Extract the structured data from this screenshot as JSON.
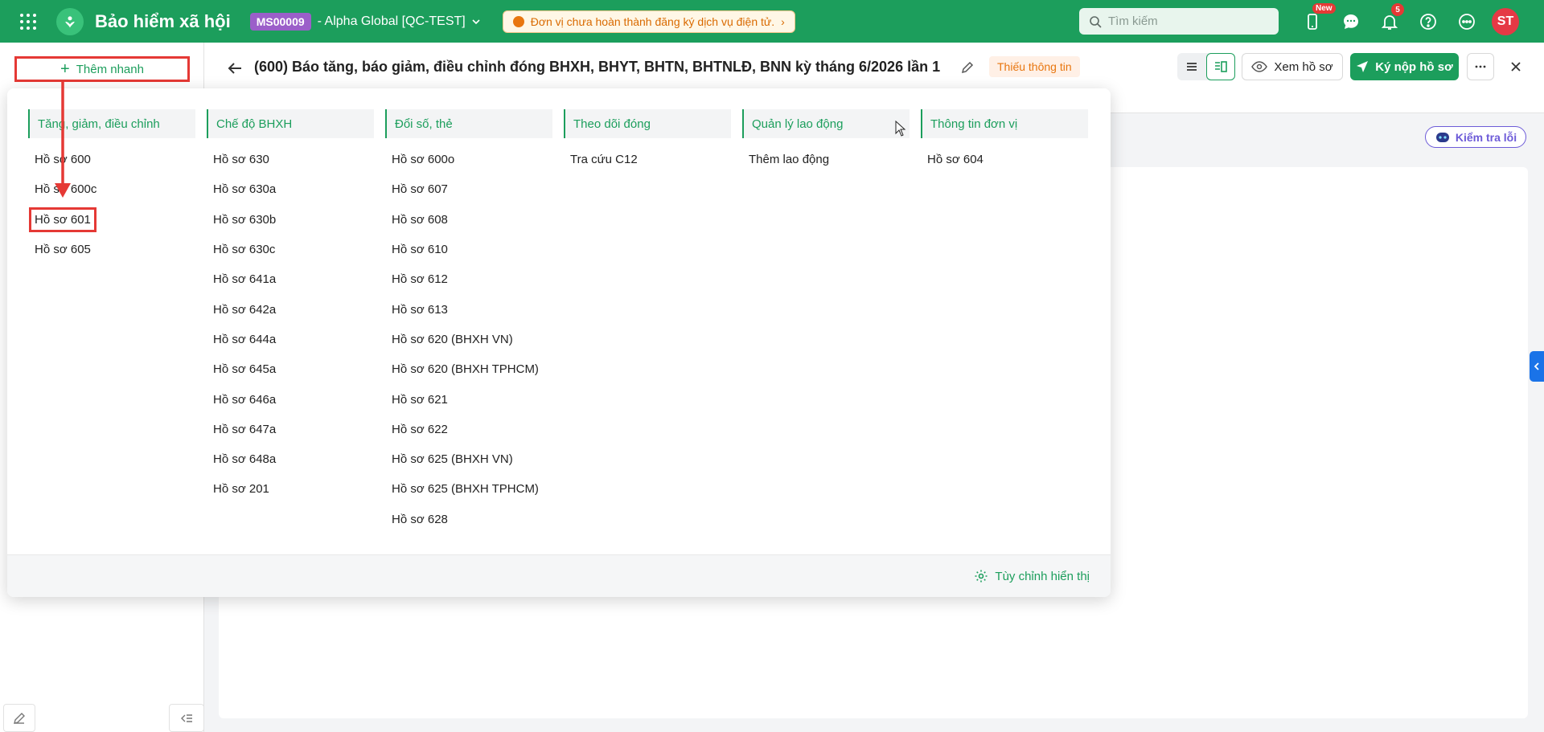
{
  "topbar": {
    "app_title": "Bảo hiểm xã hội",
    "org_code": "MS00009",
    "org_name": "- Alpha Global [QC-TEST]",
    "warning": "Đơn vị chưa hoàn thành đăng ký dịch vụ điện tử.",
    "search_placeholder": "Tìm kiếm",
    "new_badge": "New",
    "notification_count": "5",
    "avatar_initials": "ST",
    "colors": {
      "brand": "#1c9e5c",
      "org_badge": "#9b5fc9",
      "avatar": "#e53945"
    }
  },
  "sidebar": {
    "quick_add_label": "Thêm nhanh"
  },
  "header": {
    "title": "(600) Báo tăng, báo giảm, điều chỉnh đóng BHXH, BHYT, BHTN, BHTNLĐ, BNN kỳ tháng 6/2026 lần 1",
    "status_badge": "Thiếu thông tin",
    "view_button": "Xem hồ sơ",
    "submit_button": "Ký nộp hồ sơ"
  },
  "check_button": "Kiểm tra lỗi",
  "dropdown": {
    "columns": [
      {
        "title": "Tăng, giảm, điều chỉnh",
        "items": [
          "Hồ sơ 600",
          "Hồ sơ 600c",
          "Hồ sơ 601",
          "Hồ sơ 605"
        ]
      },
      {
        "title": "Chế độ BHXH",
        "items": [
          "Hồ sơ 630",
          "Hồ sơ 630a",
          "Hồ sơ 630b",
          "Hồ sơ 630c",
          "Hồ sơ 641a",
          "Hồ sơ 642a",
          "Hồ sơ 644a",
          "Hồ sơ 645a",
          "Hồ sơ 646a",
          "Hồ sơ 647a",
          "Hồ sơ 648a",
          "Hồ sơ 201"
        ]
      },
      {
        "title": "Đổi số, thẻ",
        "items": [
          "Hồ sơ 600o",
          "Hồ sơ 607",
          "Hồ sơ 608",
          "Hồ sơ 610",
          "Hồ sơ 612",
          "Hồ sơ 613",
          "Hồ sơ 620 (BHXH VN)",
          "Hồ sơ 620 (BHXH TPHCM)",
          "Hồ sơ 621",
          "Hồ sơ 622",
          "Hồ sơ 625 (BHXH VN)",
          "Hồ sơ 625 (BHXH TPHCM)",
          "Hồ sơ 628"
        ]
      },
      {
        "title": "Theo dõi đóng",
        "items": [
          "Tra cứu C12"
        ]
      },
      {
        "title": "Quản lý lao động",
        "items": [
          "Thêm lao động"
        ]
      },
      {
        "title": "Thông tin đơn vị",
        "items": [
          "Hồ sơ 604"
        ]
      }
    ],
    "highlighted_item": "Hồ sơ 601",
    "footer_label": "Tùy chỉnh hiển thị"
  }
}
